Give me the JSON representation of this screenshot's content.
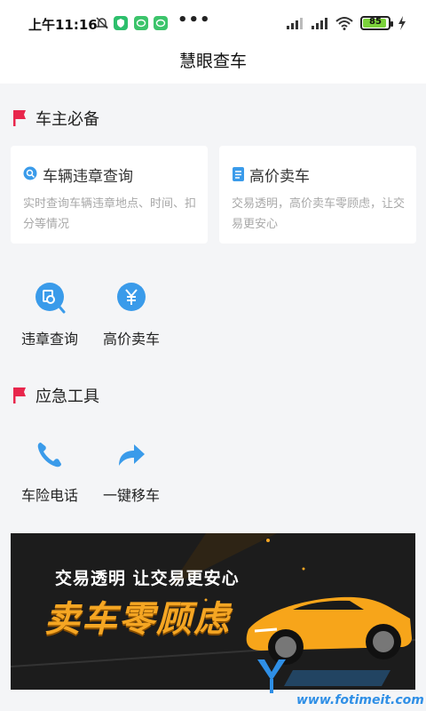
{
  "status_bar": {
    "time": "上午11:16",
    "battery_level": "85"
  },
  "header": {
    "title": "慧眼查车"
  },
  "section_owner": {
    "title": "车主必备",
    "cards": [
      {
        "title": "车辆违章查询",
        "description": "实时查询车辆违章地点、时间、扣分等情况",
        "icon": "search-icon"
      },
      {
        "title": "高价卖车",
        "description": "交易透明，高价卖车零顾虑，让交易更安心",
        "icon": "document-icon"
      }
    ],
    "tiles": [
      {
        "label": "违章查询",
        "icon": "violation-search-icon"
      },
      {
        "label": "高价卖车",
        "icon": "yuan-icon"
      }
    ]
  },
  "section_emergency": {
    "title": "应急工具",
    "tiles": [
      {
        "label": "车险电话",
        "icon": "phone-icon"
      },
      {
        "label": "一键移车",
        "icon": "move-car-arrow-icon"
      }
    ]
  },
  "banner": {
    "line1_a": "交易透明",
    "line1_b": "让交易更安心",
    "line2": "卖车零顾虑"
  },
  "watermark": {
    "url": "www.fotimeit.com"
  },
  "colors": {
    "accent_blue": "#3a9bea",
    "flag_red": "#e8264c",
    "banner_orange": "#f5a623"
  }
}
